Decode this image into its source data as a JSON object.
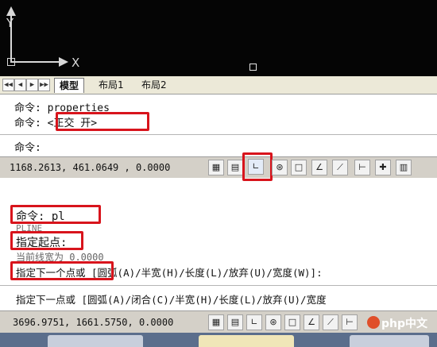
{
  "top": {
    "axis_x_label": "X",
    "axis_y_label": "Y",
    "tabs": [
      "模型",
      "布局1",
      "布局2"
    ],
    "nav_buttons": [
      "◀◀",
      "◀",
      "▶",
      "▶▶"
    ],
    "command_lines": [
      "命令: properties",
      "命令: <正交 开>",
      "命令:"
    ],
    "status_coords": "1168.2613, 461.0649 , 0.0000"
  },
  "bottom": {
    "command_lines": [
      "命令: pl",
      "PLINE",
      "指定起点:",
      "当前线宽为 0.0000",
      "指定下一个点或 [圆弧(A)/半宽(H)/长度(L)/放弃(U)/宽度(W)]:",
      "指定下一点或 [圆弧(A)/闭合(C)/半宽(H)/长度(L)/放弃(U)/宽度"
    ],
    "status_coords": "3696.9751, 1661.5750, 0.0000",
    "watermark": "php中文网"
  },
  "status_icons": [
    "snap-icon",
    "grid-icon",
    "ortho-icon",
    "polar-icon",
    "osnap-icon",
    "otrack-icon",
    "ducs-icon",
    "dyn-icon",
    "lwt-icon",
    "model-icon"
  ],
  "colors": {
    "highlight": "#d8141c",
    "canvas": "#050505",
    "status_bar": "#d4d0c8"
  }
}
